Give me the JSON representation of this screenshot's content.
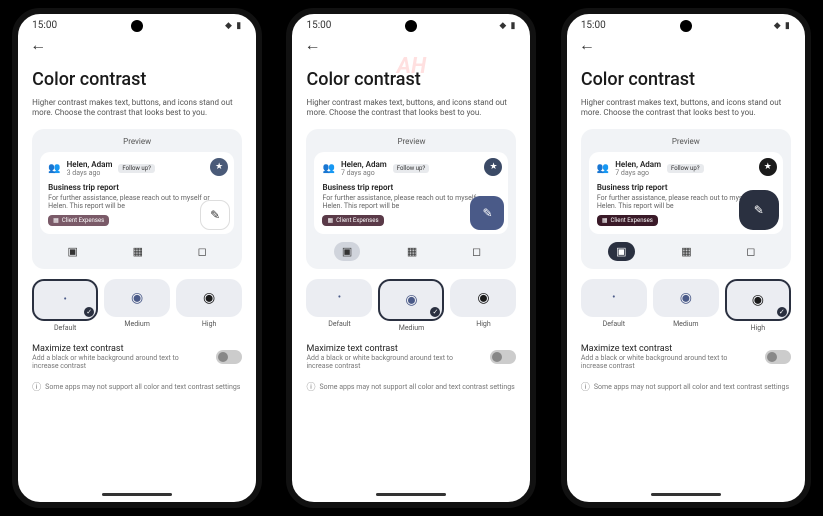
{
  "status": {
    "time": "15:00",
    "icons": "◆ ▮"
  },
  "page": {
    "title": "Color contrast",
    "description": "Higher contrast makes text, buttons, and icons stand out more. Choose the contrast that looks best to you."
  },
  "preview": {
    "label": "Preview",
    "sender": "Helen, Adam",
    "age_1": "3 days ago",
    "age_2": "7 days ago",
    "age_3": "7 days ago",
    "tag": "Follow up?",
    "subject": "Business trip report",
    "body": "For further assistance, please reach out to myself or Helen. This report will be",
    "chip": "Client Expenses"
  },
  "options": {
    "default": "Default",
    "medium": "Medium",
    "high": "High"
  },
  "maximize": {
    "title": "Maximize text contrast",
    "subtitle": "Add a black or white background around text to increase contrast"
  },
  "footnote": "Some apps may not support all color and text contrast settings",
  "watermark": "AH"
}
